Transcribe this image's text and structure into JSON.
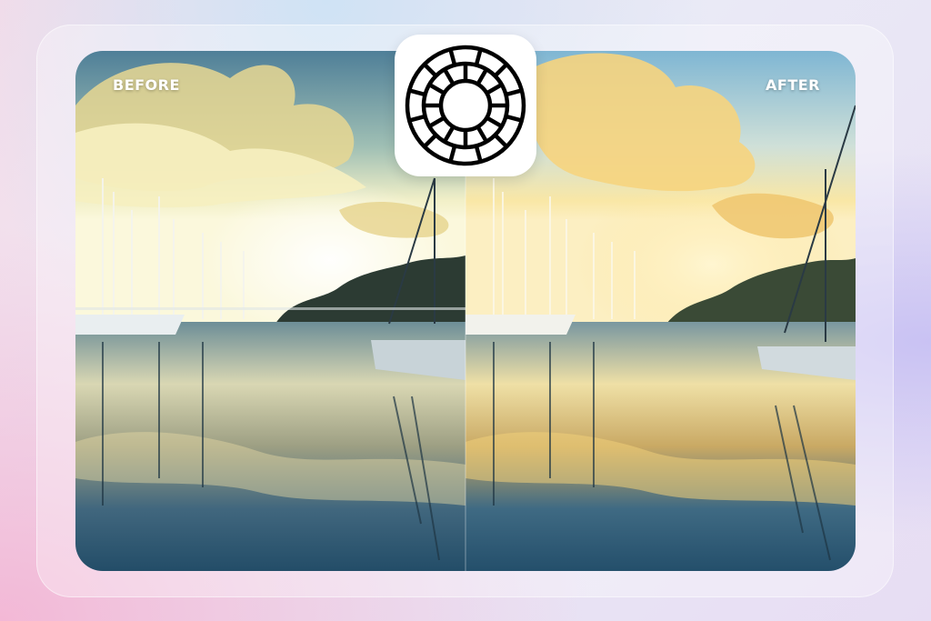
{
  "labels": {
    "before": "BEFORE",
    "after": "AFTER"
  },
  "logo": {
    "icon": "vsco-logo-icon"
  },
  "colors": {
    "before_sky_top": "#5f8fa8",
    "before_glow": "#f4f1c9",
    "after_sky_top": "#8fc1db",
    "after_glow": "#f7dc8a",
    "water": "#2e5d78"
  }
}
